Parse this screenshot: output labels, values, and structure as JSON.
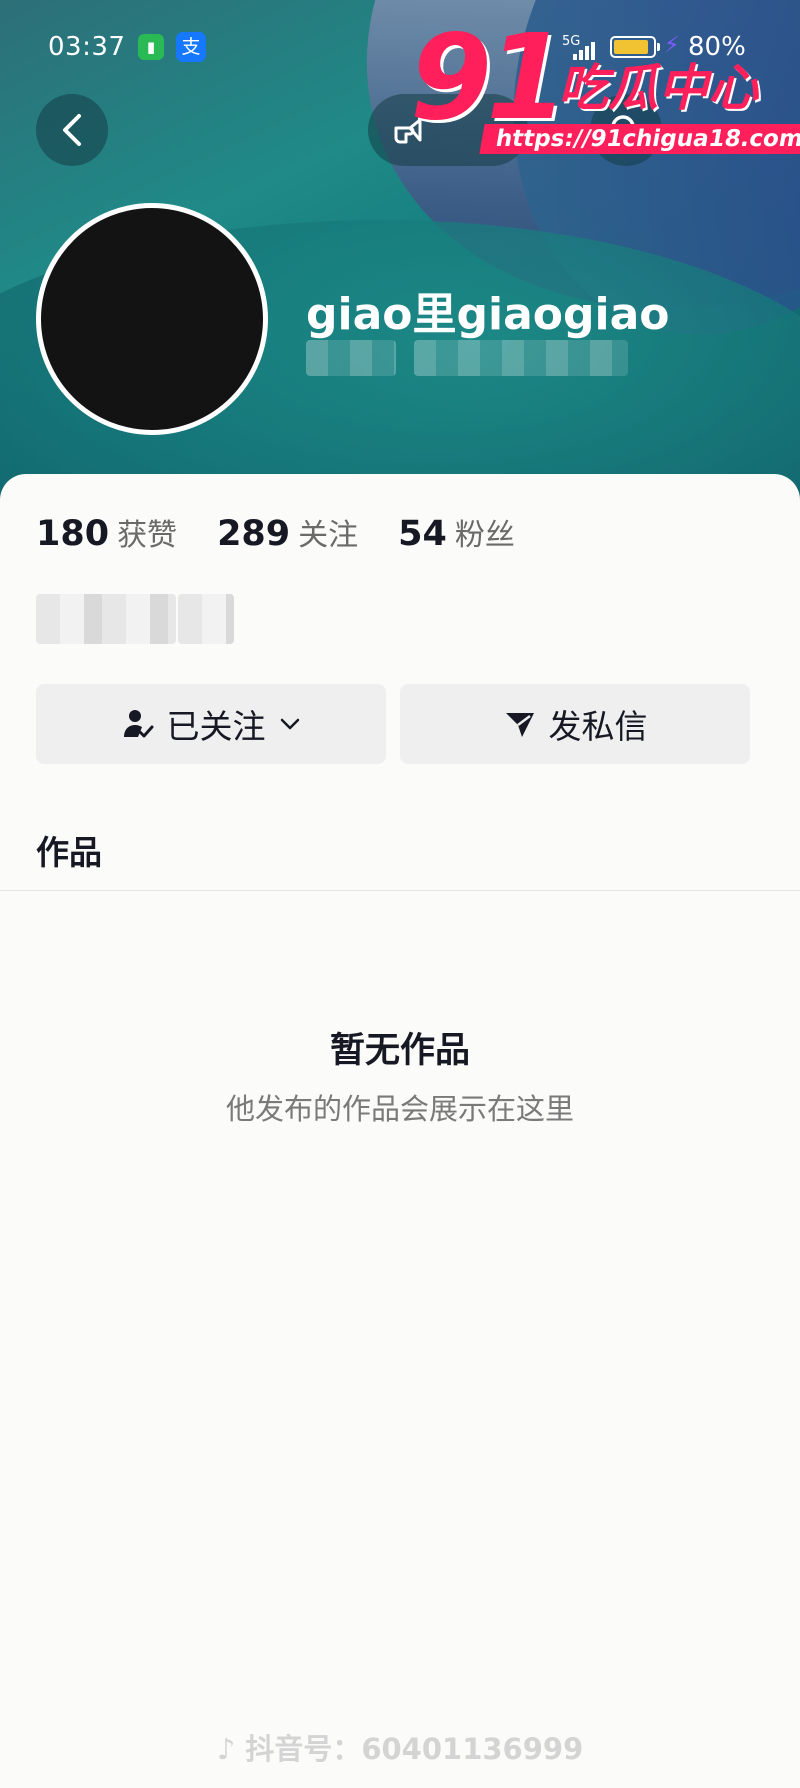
{
  "status_bar": {
    "time": "03:37",
    "app_icon_1": "支",
    "network": "5G",
    "battery_percent": "80%",
    "battery_level": 0.8
  },
  "watermark": {
    "number": "91",
    "text": "吃瓜中心",
    "url": "https://91chigua18.com"
  },
  "profile": {
    "username": "giao里giaogiao"
  },
  "stats": {
    "likes_count": "180",
    "likes_label": "获赞",
    "following_count": "289",
    "following_label": "关注",
    "followers_count": "54",
    "followers_label": "粉丝"
  },
  "actions": {
    "follow_label": "已关注",
    "message_label": "发私信"
  },
  "tabs": {
    "works_label": "作品"
  },
  "empty_state": {
    "title": "暂无作品",
    "subtitle": "他发布的作品会展示在这里"
  },
  "footer": {
    "douyin_id": "抖音号：60401136999"
  },
  "icons": [
    "back-icon",
    "share-icon",
    "search-icon",
    "user-check-icon",
    "chevron-down-icon",
    "send-icon",
    "douyin-logo-icon"
  ],
  "colors": {
    "accent_watermark": "#ff1f5a",
    "button_bg": "#efefef",
    "text_primary": "#161823"
  }
}
